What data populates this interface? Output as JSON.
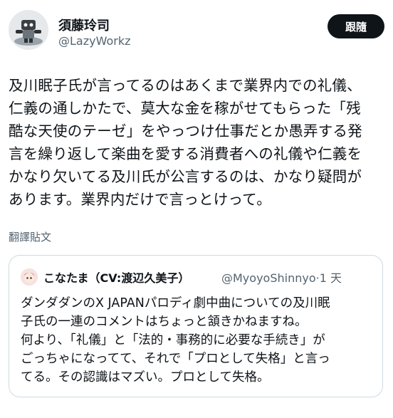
{
  "author": {
    "display_name": "須藤玲司",
    "handle": "@LazyWorkz",
    "avatar_icon": "robot-figure-avatar"
  },
  "follow_button": {
    "label": "跟隨"
  },
  "tweet": {
    "text": "及川眠子氏が言ってるのはあくまで業界内での礼儀、\n仁義の通しかたで、莫大な金を稼がせてもらった「残\n酷な天使のテーゼ」をやっつけ仕事だとか愚弄する発\n言を繰り返して楽曲を愛する消費者への礼儀や仁義を\nかなり欠いてる及川氏が公言するのは、かなり疑問が\nあります。業界内だけで言っとけって。",
    "translate_label": "翻譯貼文"
  },
  "quoted_tweet": {
    "display_name": "こなたま（CV:渡辺久美子）",
    "handle": "@MyoyoShinnyo",
    "separator": "·",
    "time": "1 天",
    "avatar_icon": "anime-avatar",
    "text": "ダンダダンのX JAPANパロディ劇中曲についての及川眠\n子氏の一連のコメントはちょっと頷きかねますね。\n何より、「礼儀」と「法的・事務的に必要な手続き」が\nごっちゃになってて、それで「プロとして失格」と言っ\nてる。その認識はマズい。プロとして失格。"
  }
}
